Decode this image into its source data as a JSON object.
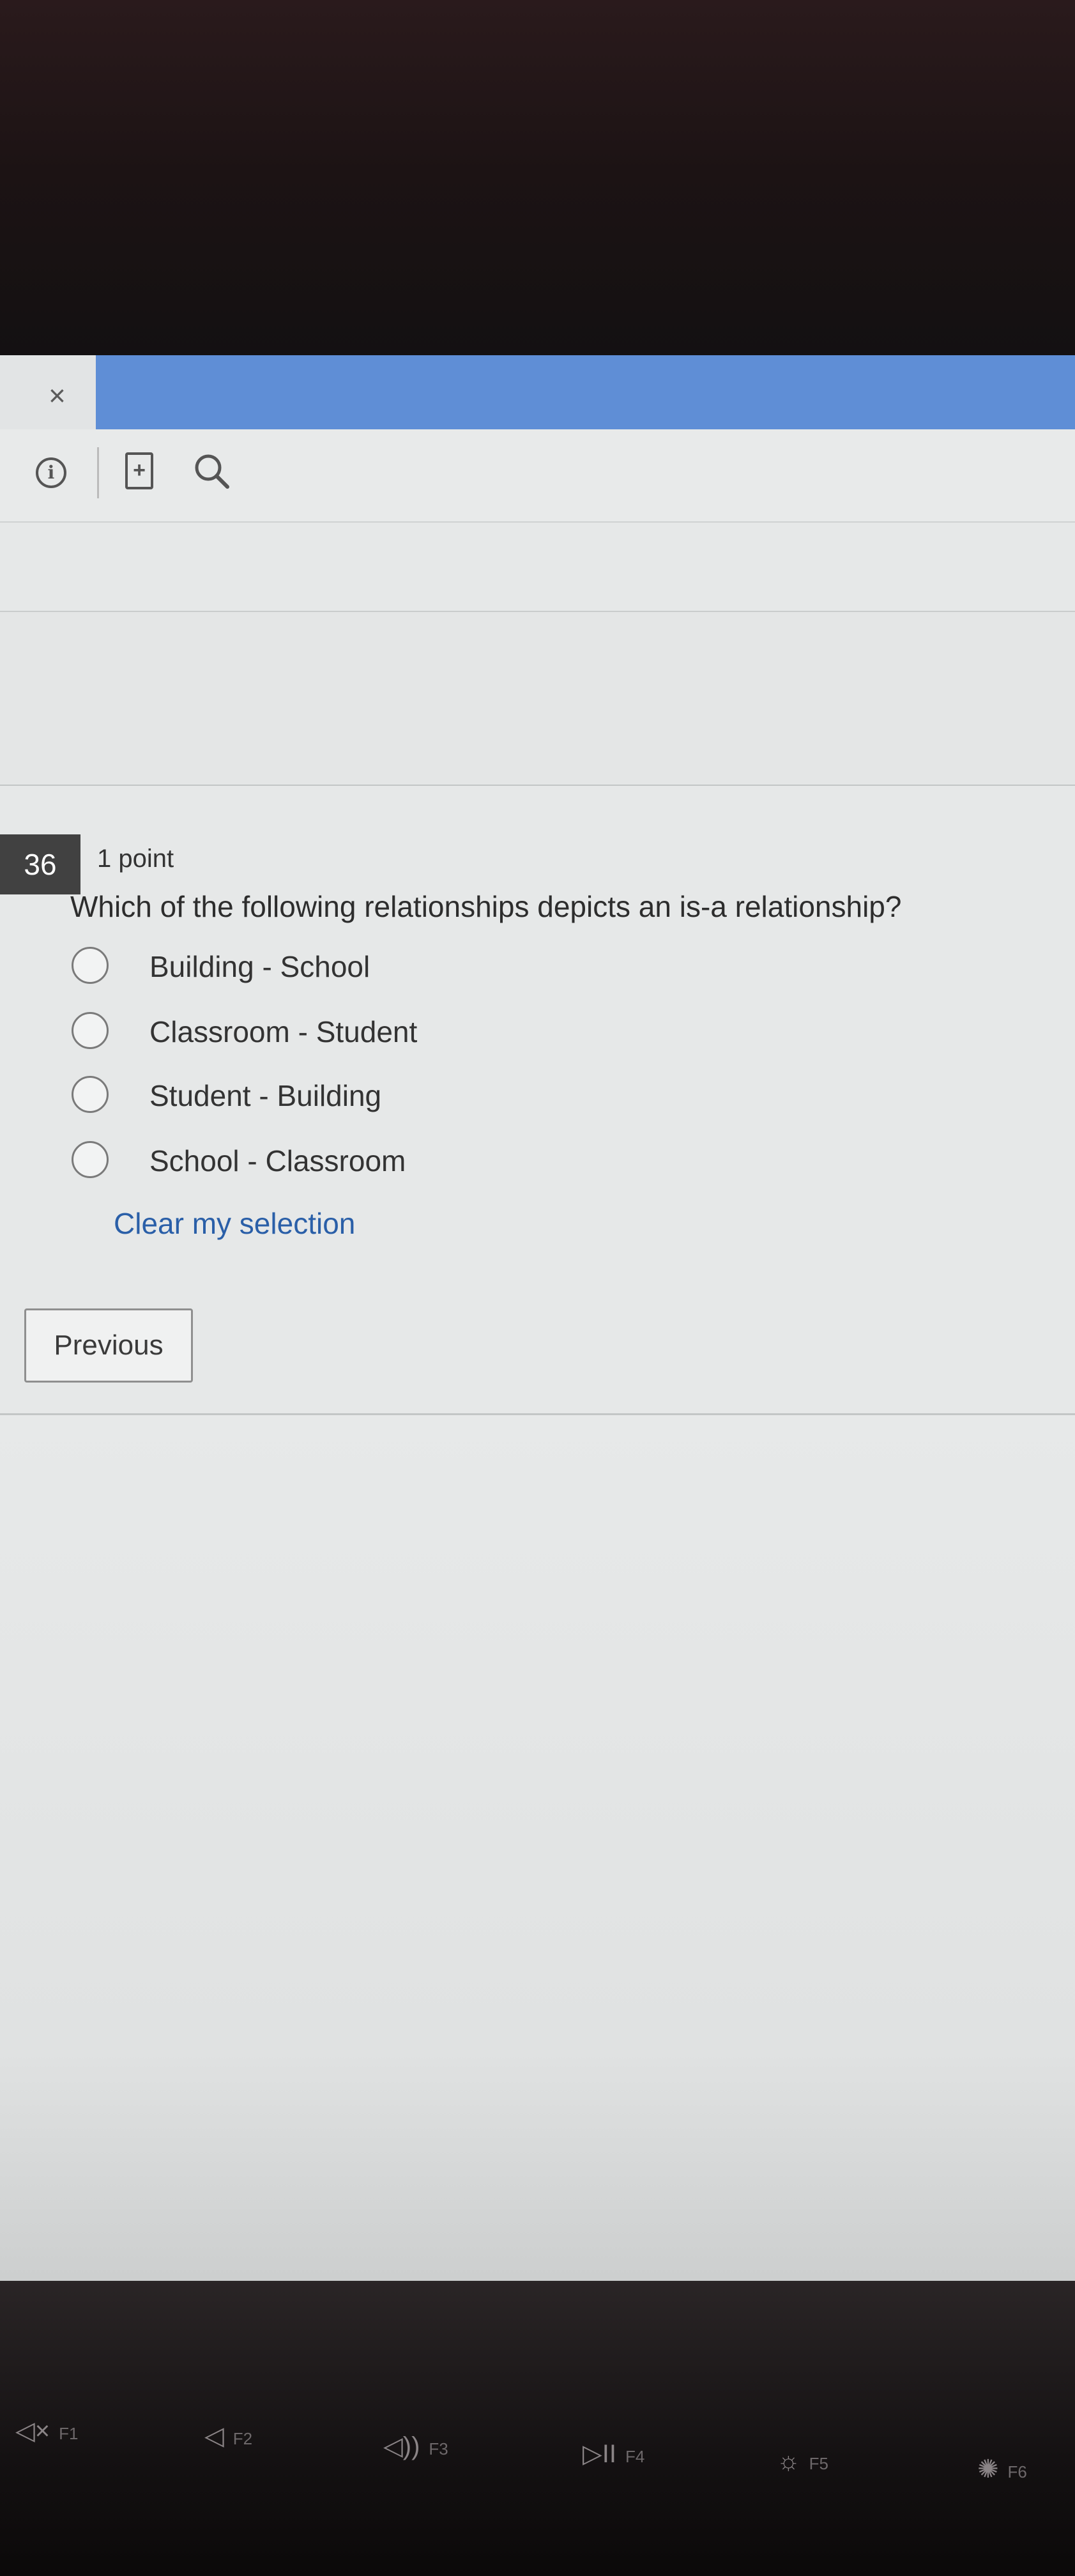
{
  "window": {
    "close_glyph": "×"
  },
  "toolbar": {
    "icons": [
      "info-icon",
      "add-document-icon",
      "search-icon"
    ]
  },
  "question": {
    "number": "36",
    "points": "1 point",
    "text": "Which of the following relationships depicts an is-a relationship?",
    "options": [
      "Building - School",
      "Classroom - Student",
      "Student - Building",
      "School - Classroom"
    ],
    "selected": null,
    "clear_label": "Clear my selection"
  },
  "navigation": {
    "previous_label": "Previous"
  },
  "keyboard": {
    "function_keys": [
      "F1",
      "F2",
      "F3",
      "F4",
      "F5",
      "F6"
    ]
  }
}
